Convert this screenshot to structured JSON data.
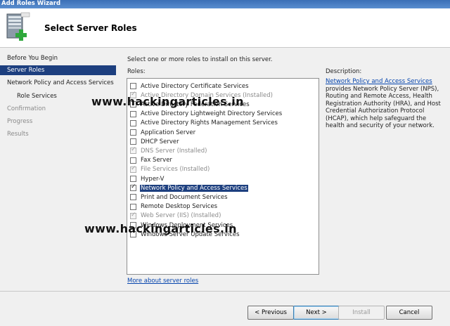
{
  "window": {
    "title": "Add Roles Wizard"
  },
  "header": {
    "title": "Select Server Roles",
    "icon": "server-add-icon"
  },
  "sidebar": {
    "items": [
      {
        "label": "Before You Begin",
        "state": "normal"
      },
      {
        "label": "Server Roles",
        "state": "selected"
      },
      {
        "label": "Network Policy and Access Services",
        "state": "normal"
      },
      {
        "label": "Role Services",
        "state": "normal"
      },
      {
        "label": "Confirmation",
        "state": "disabled"
      },
      {
        "label": "Progress",
        "state": "disabled"
      },
      {
        "label": "Results",
        "state": "disabled"
      }
    ]
  },
  "main": {
    "instruction": "Select one or more roles to install on this server.",
    "roles_label": "Roles:",
    "roles": [
      {
        "label": "Active Directory Certificate Services",
        "checked": false,
        "installed": false
      },
      {
        "label": "Active Directory Domain Services  (Installed)",
        "checked": true,
        "installed": true
      },
      {
        "label": "Active Directory Federation Services",
        "checked": false,
        "installed": false
      },
      {
        "label": "Active Directory Lightweight Directory Services",
        "checked": false,
        "installed": false
      },
      {
        "label": "Active Directory Rights Management Services",
        "checked": false,
        "installed": false
      },
      {
        "label": "Application Server",
        "checked": false,
        "installed": false
      },
      {
        "label": "DHCP Server",
        "checked": false,
        "installed": false
      },
      {
        "label": "DNS Server  (Installed)",
        "checked": true,
        "installed": true
      },
      {
        "label": "Fax Server",
        "checked": false,
        "installed": false
      },
      {
        "label": "File Services  (Installed)",
        "checked": true,
        "installed": true
      },
      {
        "label": "Hyper-V",
        "checked": false,
        "installed": false
      },
      {
        "label": "Network Policy and Access Services",
        "checked": true,
        "installed": false,
        "selected": true
      },
      {
        "label": "Print and Document Services",
        "checked": false,
        "installed": false
      },
      {
        "label": "Remote Desktop Services",
        "checked": false,
        "installed": false
      },
      {
        "label": "Web Server (IIS)  (Installed)",
        "checked": true,
        "installed": true
      },
      {
        "label": "Windows Deployment Services",
        "checked": false,
        "installed": false
      },
      {
        "label": "Windows Server Update Services",
        "checked": false,
        "installed": false
      }
    ],
    "more_link": "More about server roles",
    "description_label": "Description:",
    "description_link": "Network Policy and Access Services",
    "description_text": " provides Network Policy Server (NPS), Routing and Remote Access, Health Registration Authority (HRA), and Host Credential Authorization Protocol (HCAP), which help safeguard the health and security of your network."
  },
  "watermark": {
    "text": "www.hackingarticles.in"
  },
  "buttons": {
    "previous": "< Previous",
    "next": "Next >",
    "install": "Install",
    "cancel": "Cancel"
  }
}
